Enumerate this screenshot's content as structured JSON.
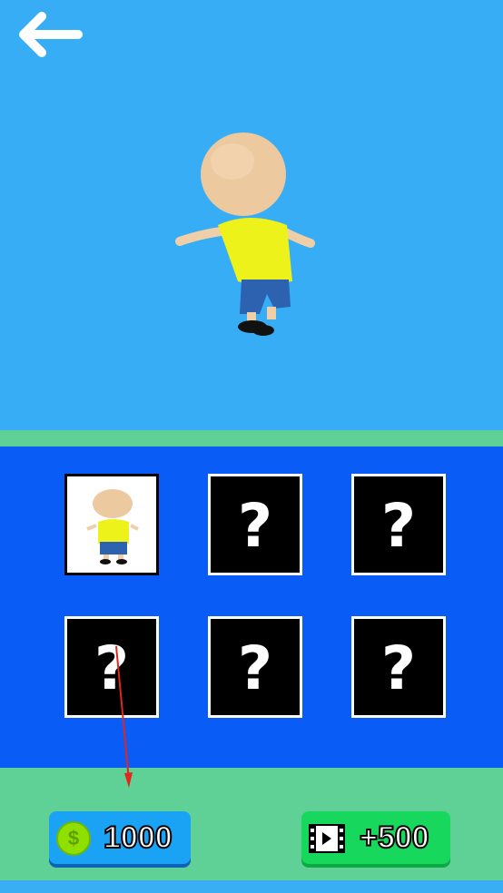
{
  "header": {
    "back_icon": "back-arrow-icon"
  },
  "preview": {
    "character": "character-model"
  },
  "skins": [
    {
      "locked": false,
      "label": ""
    },
    {
      "locked": true,
      "label": "?"
    },
    {
      "locked": true,
      "label": "?"
    },
    {
      "locked": true,
      "label": "?"
    },
    {
      "locked": true,
      "label": "?"
    },
    {
      "locked": true,
      "label": "?"
    }
  ],
  "footer": {
    "coins": "1000",
    "ad_reward": "+500",
    "coin_icon": "coin-icon",
    "video_icon": "video-icon"
  },
  "colors": {
    "sky": "#36adf4",
    "panel": "#0a5cf7",
    "strip": "#5fd096",
    "coin_button": "#1aa3f5",
    "ad_button": "#17d85c"
  }
}
